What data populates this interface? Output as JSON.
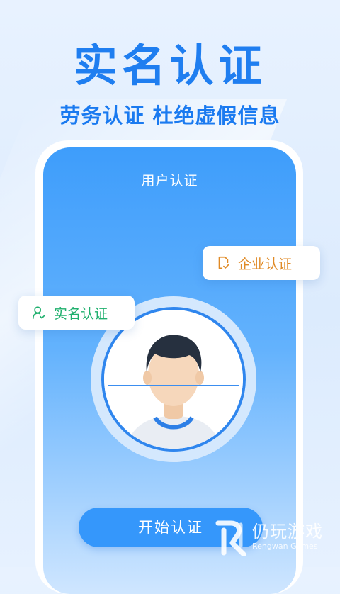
{
  "headline": "实名认证",
  "subhead": "劳务认证 杜绝虚假信息",
  "phone": {
    "screen_title": "用户认证",
    "start_button": "开始认证"
  },
  "tags": {
    "realname": {
      "label": "实名认证",
      "icon": "user-check-icon",
      "color": "#20b06e"
    },
    "enterprise": {
      "label": "企业认证",
      "icon": "document-check-icon",
      "color": "#e08a25"
    }
  },
  "watermark": {
    "title": "仍玩游戏",
    "subtitle": "Rengwan Games"
  },
  "colors": {
    "brand_blue": "#1f7ef0",
    "button_blue": "#3597fb"
  }
}
